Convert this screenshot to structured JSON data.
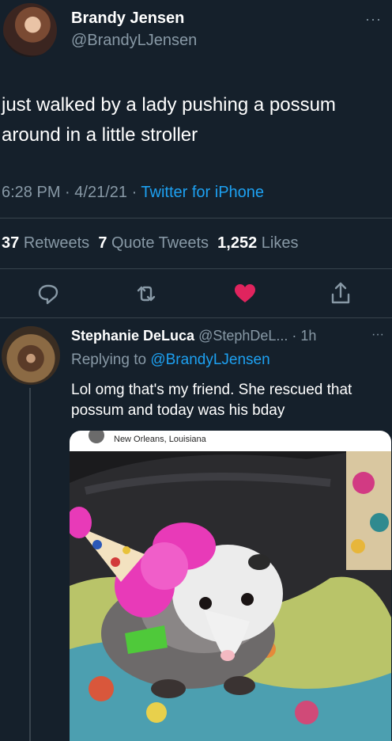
{
  "tweet": {
    "author_name": "Brandy Jensen",
    "author_handle": "@BrandyLJensen",
    "text": "just walked by a lady pushing a possum around in a little stroller",
    "time": "6:28 PM",
    "date": "4/21/21",
    "source": "Twitter for iPhone",
    "more": "···",
    "stats": {
      "retweets_count": "37",
      "retweets_label": "Retweets",
      "quote_count": "7",
      "quote_label": "Quote Tweets",
      "likes_count": "1,252",
      "likes_label": "Likes"
    }
  },
  "actions": {
    "reply_icon": "reply-icon",
    "retweet_icon": "retweet-icon",
    "like_icon": "heart-icon",
    "share_icon": "share-icon",
    "like_color": "#e0245e"
  },
  "reply": {
    "author_name": "Stephanie DeLuca",
    "author_handle": "@StephDeL...",
    "age": "· 1h",
    "more": "···",
    "replying_prefix": "Replying to",
    "replying_to": "@BrandyLJensen",
    "text": "Lol omg that's my friend. She rescued that possum and today was his bday",
    "photo_location": "New Orleans, Louisiana"
  },
  "colors": {
    "background": "#15202b",
    "muted": "#8899a6",
    "link": "#1da1f2",
    "divider": "#38444d"
  }
}
